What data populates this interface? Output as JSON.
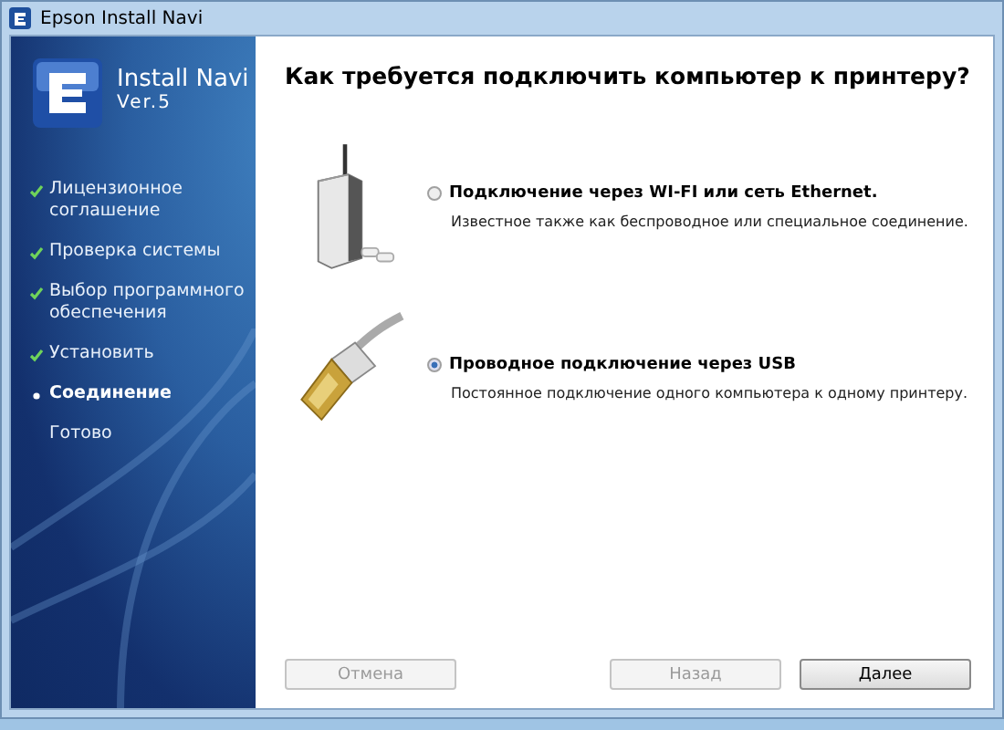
{
  "window": {
    "title": "Epson Install Navi"
  },
  "brand": {
    "name": "Install Navi",
    "version": "Ver.5"
  },
  "steps": [
    {
      "label": "Лицензионное соглашение",
      "kind": "done"
    },
    {
      "label": "Проверка системы",
      "kind": "done"
    },
    {
      "label": "Выбор программного обеспечения",
      "kind": "done"
    },
    {
      "label": "Установить",
      "kind": "done"
    },
    {
      "label": "Соединение",
      "kind": "current"
    },
    {
      "label": "Готово",
      "kind": "pending"
    }
  ],
  "heading": "Как требуется подключить компьютер к принтеру?",
  "options": [
    {
      "kind": "wireless",
      "label": "Подключение через WI-FI или сеть Ethernet.",
      "description": "Известное также как беспроводное или специальное соединение.",
      "selected": false
    },
    {
      "kind": "usb",
      "label": "Проводное подключение через USB",
      "description": "Постоянное подключение одного компьютера к одному принтеру.",
      "selected": true
    }
  ],
  "left_buttons": [
    {
      "label": "Отмена",
      "disabled": true
    }
  ],
  "right_buttons": [
    {
      "label": "Назад",
      "disabled": true
    },
    {
      "label": "Далее",
      "disabled": false
    }
  ]
}
